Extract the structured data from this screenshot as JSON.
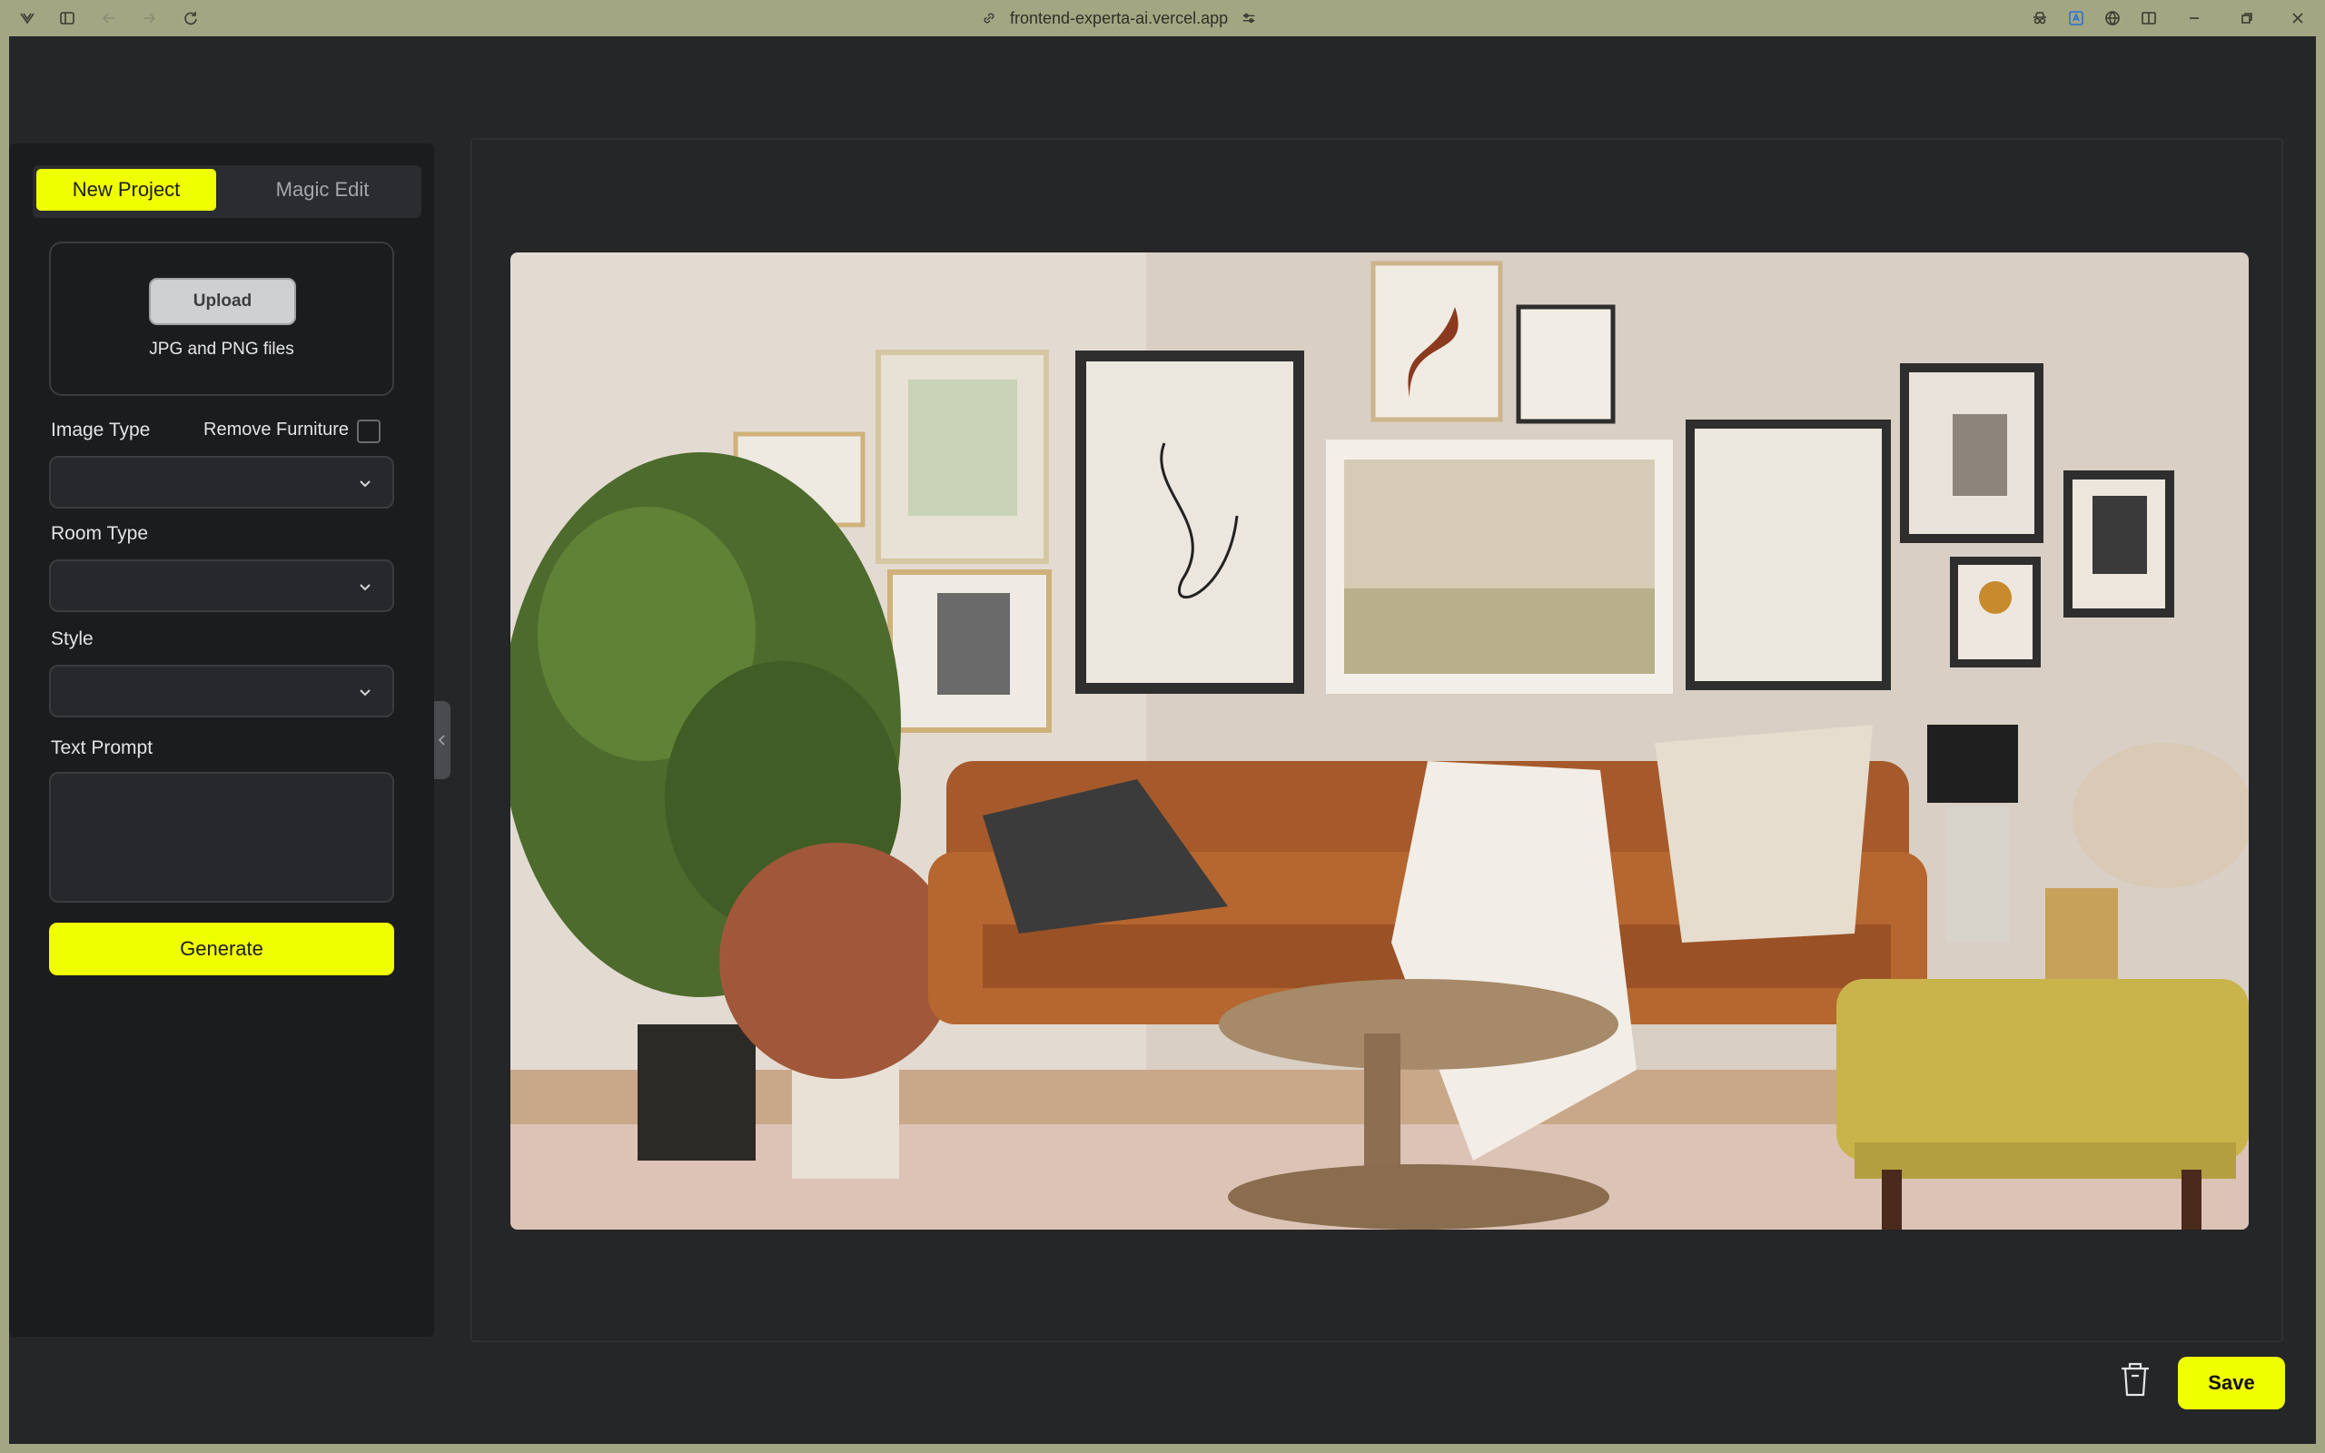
{
  "browser": {
    "url": "frontend-experta-ai.vercel.app"
  },
  "sidebar": {
    "tabs": [
      {
        "label": "New Project",
        "active": true
      },
      {
        "label": "Magic Edit",
        "active": false
      }
    ],
    "upload": {
      "button_label": "Upload",
      "hint": "JPG and PNG files"
    },
    "image_type": {
      "label": "Image Type",
      "value": ""
    },
    "remove_furniture": {
      "label": "Remove Furniture",
      "checked": false
    },
    "room_type": {
      "label": "Room Type",
      "value": ""
    },
    "style": {
      "label": "Style",
      "value": ""
    },
    "text_prompt": {
      "label": "Text Prompt",
      "value": ""
    },
    "generate_label": "Generate"
  },
  "actions": {
    "save_label": "Save",
    "delete_icon": "trash-icon"
  },
  "colors": {
    "accent": "#f0ff00",
    "app_background": "#252628",
    "sidebar_background": "#1b1c1e",
    "browser_frame": "#a3a683"
  }
}
